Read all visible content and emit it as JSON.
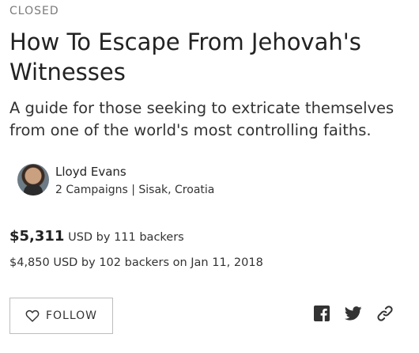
{
  "campaign": {
    "status": "CLOSED",
    "title": "How To Escape From Jehovah's Witnesses",
    "subtitle": "A guide for those seeking to extricate themselves from one of the world's most controlling faiths."
  },
  "creator": {
    "name": "Lloyd Evans",
    "meta": "2 Campaigns | Sisak, Croatia"
  },
  "funding": {
    "amount": "$5,311",
    "amount_suffix": " USD by 111 backers",
    "previous": "$4,850 USD by 102 backers on Jan 11, 2018"
  },
  "actions": {
    "follow_label": "FOLLOW"
  },
  "share": {
    "icons": [
      "facebook-icon",
      "twitter-icon",
      "link-icon"
    ],
    "icon_color": "#333333"
  },
  "colors": {
    "status_gray": "#7a7a7a",
    "text_dark": "#222222",
    "border": "#bdbdbd"
  }
}
